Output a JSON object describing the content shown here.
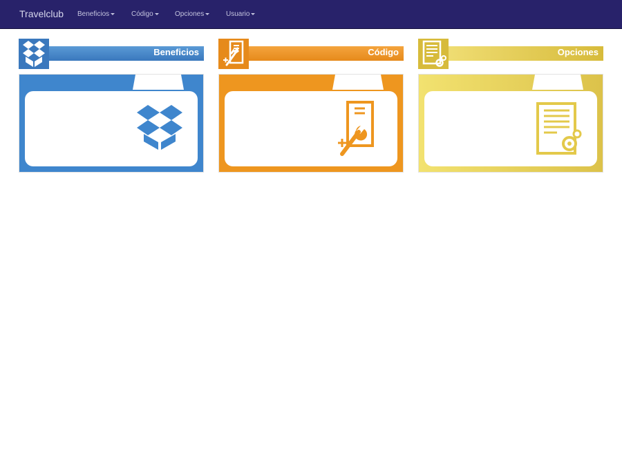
{
  "navbar": {
    "brand": "Travelclub",
    "items": [
      {
        "label": "Beneficios"
      },
      {
        "label": "Código"
      },
      {
        "label": "Opciones"
      },
      {
        "label": "Usuario"
      }
    ]
  },
  "cards": [
    {
      "title": "Beneficios",
      "color": "#3f86cd",
      "icon": "dropbox-box-icon"
    },
    {
      "title": "Código",
      "color": "#ee961f",
      "icon": "code-document-wrench-icon"
    },
    {
      "title": "Opciones",
      "color": "#e8d35a",
      "icon": "document-gear-icon"
    }
  ],
  "colors": {
    "navbar": "#28226a",
    "blue": "#3f86cd",
    "orange": "#ee961f",
    "yellow": "#e8d35a"
  }
}
